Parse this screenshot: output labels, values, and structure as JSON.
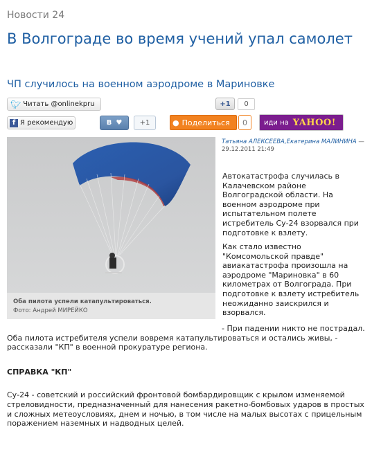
{
  "section": "Новости 24",
  "headline": "В Волгограде во время учений упал самолет",
  "subheadline": "ЧП случилось на военном аэродроме в Мариновке",
  "share": {
    "twitter_label": "Читать @onlinekpru",
    "gplus_label": "+1",
    "gplus_count": "0",
    "facebook_label": "Я рекомендую",
    "vk_label": "B",
    "vk_plus": "+1",
    "ok_label": "Поделиться",
    "ok_count": "0",
    "yahoo_prefix": "иди на",
    "yahoo_logo": "YAHOO!"
  },
  "photo": {
    "caption": "Оба пилота успели катапультироваться.",
    "credit": "Фото: Андрей МИРЕЙКО"
  },
  "byline": {
    "authors": "Татьяна АЛЕКСЕЕВА,Екатерина МАЛИНИНА",
    "date": "— 29.12.2011 21:49"
  },
  "paragraphs": [
    "Автокатастрофа случилась в Калачевском районе Волгоградской области. На военном аэродроме при испытательном полете истребитель Су-24 взорвался при подготовке к взлету.",
    "Как стало известно \"Комсомольской правде\" авиакатастрофа произошла на аэродроме \"Мариновка\" в 60 километрах от Волгограда. При подготовке к взлету истребитель неожиданно заискрился и взорвался.",
    "- При падении никто не пострадал. Оба пилота истребителя успели вовремя катапультироваться и остались живы, - рассказали \"КП\" в военной прокуратуре региона."
  ],
  "reference": {
    "title": "СПРАВКА \"КП\"",
    "text": "Су-24 - советский и российский фронтовой бомбардировщик с крылом изменяемой стреловидности, предназначенный для нанесения ракетно-бомбовых ударов в простых и сложных метеоусловиях, днем и ночью, в том числе на малых высотах с прицельным поражением наземных и надводных целей."
  },
  "colors": {
    "link_blue": "#1f5fa3",
    "ok_orange": "#f28220",
    "yahoo_purple": "#7b1d8e"
  }
}
